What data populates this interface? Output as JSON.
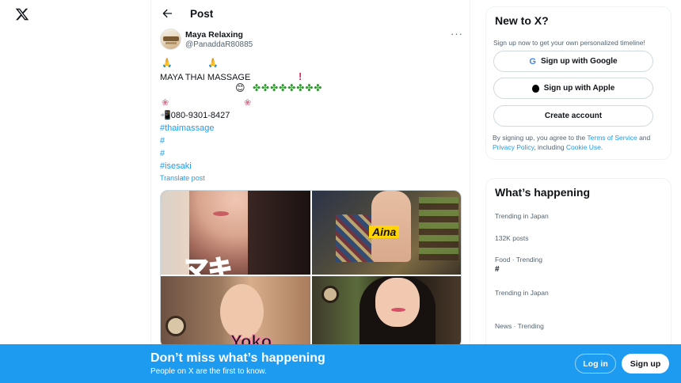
{
  "header": {
    "title": "Post"
  },
  "post": {
    "author_name": "Maya Relaxing",
    "author_handle": "@PanaddaR80885",
    "more": "···",
    "shop_name": "MAYA THAI MASSAGE",
    "phone": "080-9301-8427",
    "hashtag1": "#thaimassage",
    "hashtag2": "#",
    "hashtag3": "#",
    "hashtag4": "#isesaki",
    "translate": "Translate post",
    "media_labels": [
      "Aina",
      "Yoko"
    ]
  },
  "signup_card": {
    "title": "New to X?",
    "subtitle": "Sign up now to get your own personalized timeline!",
    "google_label": "Sign up with Google",
    "apple_label": "Sign up with Apple",
    "create_label": "Create account",
    "legal_prefix": "By signing up, you agree to the ",
    "terms": "Terms of Service",
    "and": " and ",
    "privacy": "Privacy Policy",
    "including": ", including ",
    "cookie": "Cookie Use",
    "period": "."
  },
  "trends": {
    "title": "What’s happening",
    "items": [
      {
        "meta": "Trending in Japan"
      },
      {
        "meta": "132K posts"
      },
      {
        "meta": "Food · Trending",
        "title": "#"
      },
      {
        "meta": "Trending in Japan"
      },
      {
        "meta": "News · Trending"
      }
    ]
  },
  "banner": {
    "headline": "Don’t miss what’s happening",
    "subline": "People on X are the first to know.",
    "login": "Log in",
    "signup": "Sign up"
  },
  "colors": {
    "accent": "#1d9bf0",
    "text": "#0f1419",
    "muted": "#536471",
    "border": "#eff3f4"
  }
}
